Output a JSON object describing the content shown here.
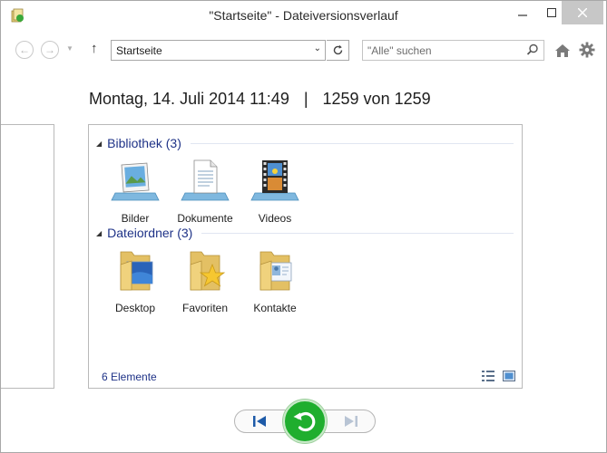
{
  "window": {
    "title": "\"Startseite\" - Dateiversionsverlauf"
  },
  "toolbar": {
    "address_value": "Startseite",
    "search_placeholder": "\"Alle\" suchen"
  },
  "snapshot": {
    "datetime": "Montag, 14. Juli 2014 11:49",
    "separator": "|",
    "position": "1259 von 1259"
  },
  "groups": [
    {
      "label": "Bibliothek (3)",
      "items": [
        {
          "label": "Bilder",
          "icon": "pictures-library-icon"
        },
        {
          "label": "Dokumente",
          "icon": "documents-library-icon"
        },
        {
          "label": "Videos",
          "icon": "videos-library-icon"
        }
      ]
    },
    {
      "label": "Dateiordner (3)",
      "items": [
        {
          "label": "Desktop",
          "icon": "desktop-folder-icon"
        },
        {
          "label": "Favoriten",
          "icon": "favorites-folder-icon"
        },
        {
          "label": "Kontakte",
          "icon": "contacts-folder-icon"
        }
      ]
    }
  ],
  "status": {
    "count": "6 Elemente"
  },
  "colors": {
    "accent_blue": "#1e3287",
    "restore_green": "#1fae2e",
    "nav_blue": "#1d5aa8"
  }
}
